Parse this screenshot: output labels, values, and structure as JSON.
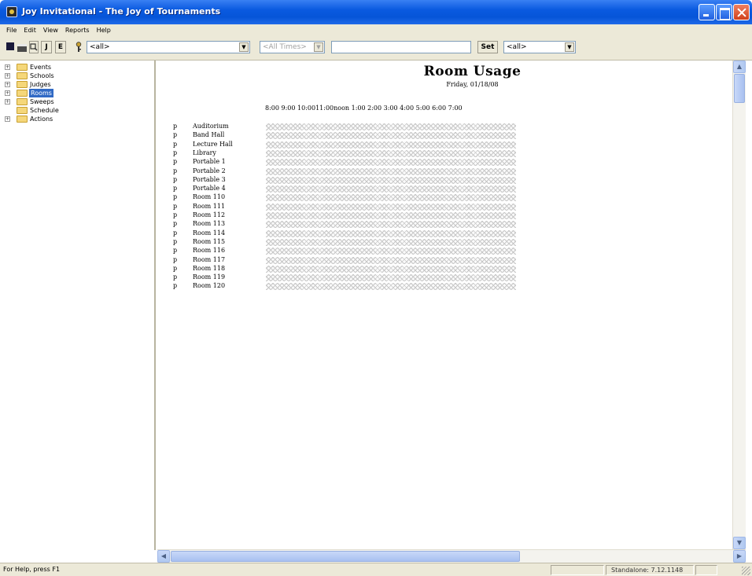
{
  "window": {
    "title": "Joy Invitational - The Joy of Tournaments"
  },
  "menu": [
    "File",
    "Edit",
    "View",
    "Reports",
    "Help"
  ],
  "toolbar": {
    "preview_label": "",
    "j_label": "J",
    "e_label": "E",
    "combo1_value": "<all>",
    "combo2_value": "<All Times>",
    "text_value": "",
    "set_label": "Set",
    "combo3_value": "<all>"
  },
  "tree": {
    "items": [
      {
        "label": "Events",
        "expandable": true,
        "selected": false
      },
      {
        "label": "Schools",
        "expandable": true,
        "selected": false
      },
      {
        "label": "Judges",
        "expandable": true,
        "selected": false
      },
      {
        "label": "Rooms",
        "expandable": true,
        "selected": true
      },
      {
        "label": "Sweeps",
        "expandable": true,
        "selected": false
      },
      {
        "label": "Schedule",
        "expandable": false,
        "selected": false
      },
      {
        "label": "Actions",
        "expandable": true,
        "selected": false
      }
    ]
  },
  "report": {
    "title": "Room Usage",
    "subtitle": "Friday, 01/18/08",
    "time_header": "8:00 9:00  10:0011:00noon 1:00 2:00  3:00  4:00  5:00 6:00  7:00",
    "rooms": [
      {
        "flag": "p",
        "name": "Auditorium"
      },
      {
        "flag": "p",
        "name": "Band Hall"
      },
      {
        "flag": "p",
        "name": "Lecture Hall"
      },
      {
        "flag": "p",
        "name": "Library"
      },
      {
        "flag": "p",
        "name": "Portable 1"
      },
      {
        "flag": "p",
        "name": "Portable 2"
      },
      {
        "flag": "p",
        "name": "Portable 3"
      },
      {
        "flag": "p",
        "name": "Portable 4"
      },
      {
        "flag": "p",
        "name": "Room 110"
      },
      {
        "flag": "p",
        "name": "Room 111"
      },
      {
        "flag": "p",
        "name": "Room 112"
      },
      {
        "flag": "p",
        "name": "Room 113"
      },
      {
        "flag": "p",
        "name": "Room 114"
      },
      {
        "flag": "p",
        "name": "Room 115"
      },
      {
        "flag": "p",
        "name": "Room 116"
      },
      {
        "flag": "p",
        "name": "Room 117"
      },
      {
        "flag": "p",
        "name": "Room 118"
      },
      {
        "flag": "p",
        "name": "Room 119"
      },
      {
        "flag": "p",
        "name": "Room 120"
      }
    ]
  },
  "status": {
    "help_text": "For Help, press F1",
    "mode_text": "Standalone: 7.12.1148"
  },
  "colors": {
    "titlebar": "#0a5ae0",
    "selection": "#316ac5",
    "chrome": "#ece9d8"
  }
}
